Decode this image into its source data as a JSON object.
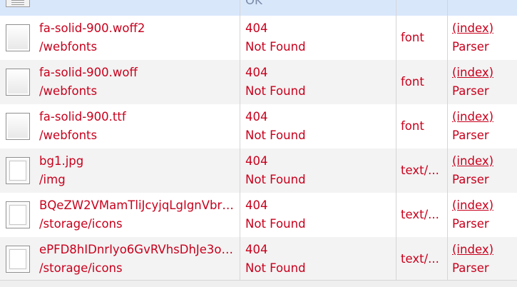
{
  "top_row": {
    "status_text": "OK"
  },
  "rows": [
    {
      "name": "fa-solid-900.woff2",
      "path": "/webfonts",
      "status_code": "404",
      "status_text": "Not Found",
      "type": "font",
      "initiator": "(index)",
      "initiator_sub": "Parser"
    },
    {
      "name": "fa-solid-900.woff",
      "path": "/webfonts",
      "status_code": "404",
      "status_text": "Not Found",
      "type": "font",
      "initiator": "(index)",
      "initiator_sub": "Parser"
    },
    {
      "name": "fa-solid-900.ttf",
      "path": "/webfonts",
      "status_code": "404",
      "status_text": "Not Found",
      "type": "font",
      "initiator": "(index)",
      "initiator_sub": "Parser"
    },
    {
      "name": "bg1.jpg",
      "path": "/img",
      "status_code": "404",
      "status_text": "Not Found",
      "type": "text/...",
      "initiator": "(index)",
      "initiator_sub": "Parser"
    },
    {
      "name": "BQeZW2VMamTliJcyjqLgIgnVbr2...",
      "path": "/storage/icons",
      "status_code": "404",
      "status_text": "Not Found",
      "type": "text/...",
      "initiator": "(index)",
      "initiator_sub": "Parser"
    },
    {
      "name": "ePFD8hIDnrIyo6GvRVhsDhJe3oV...",
      "path": "/storage/icons",
      "status_code": "404",
      "status_text": "Not Found",
      "type": "text/...",
      "initiator": "(index)",
      "initiator_sub": "Parser"
    }
  ],
  "colors": {
    "error_text": "#c8001c",
    "selected_row": "#d9e7fb",
    "alt_row": "#f3f3f3"
  }
}
